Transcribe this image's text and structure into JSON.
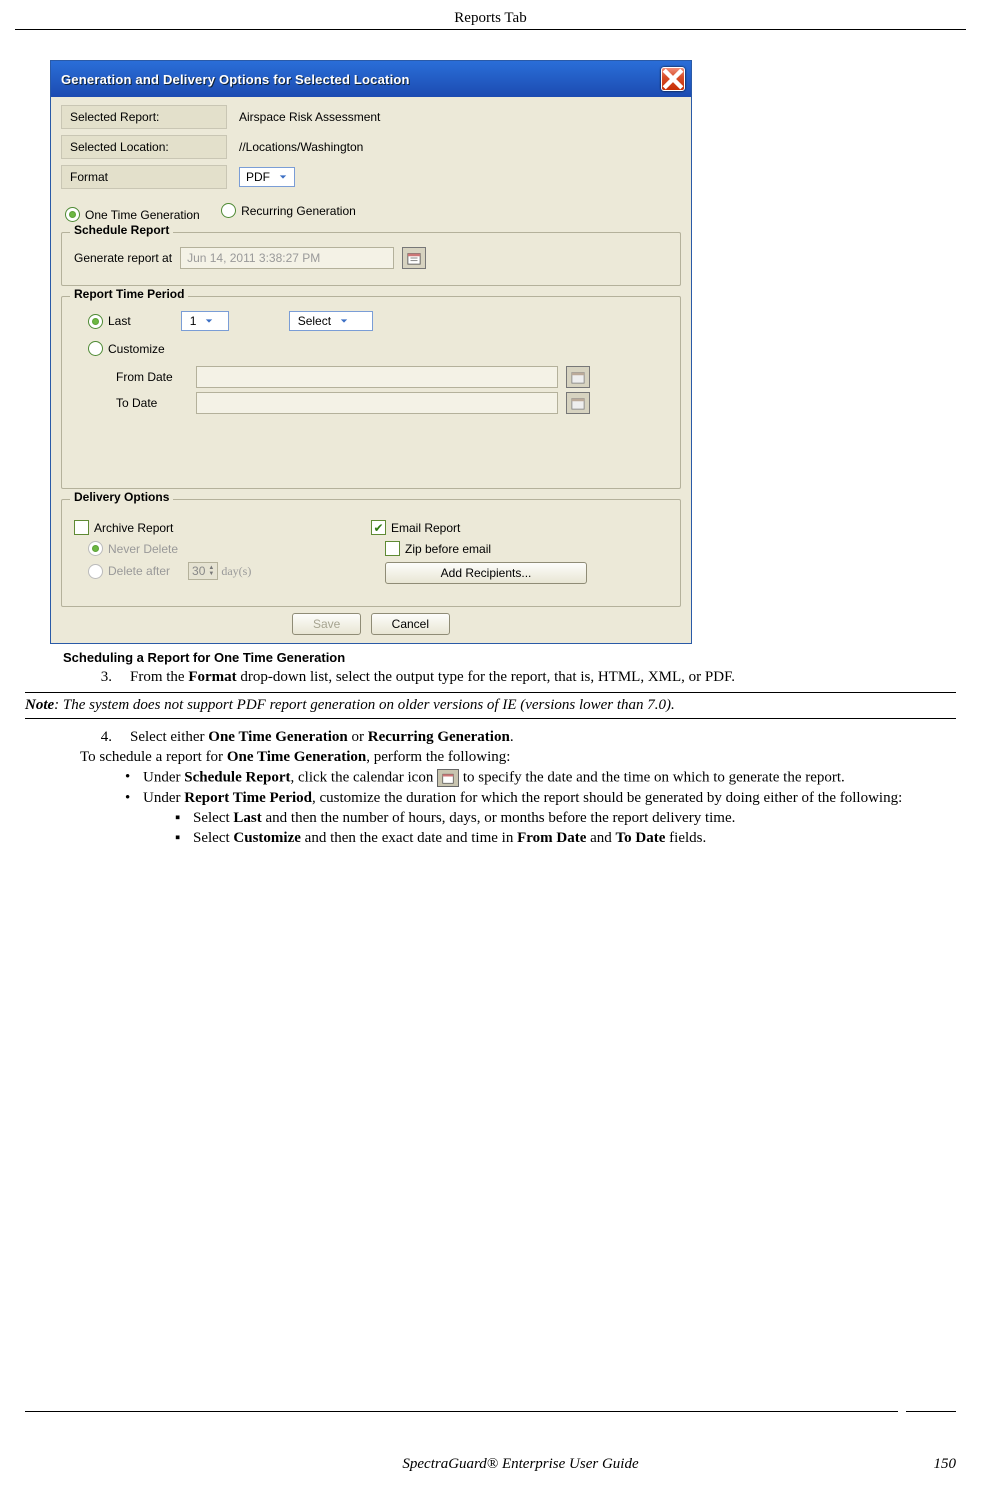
{
  "header": {
    "title": "Reports Tab"
  },
  "dialog": {
    "title": "Generation and Delivery Options for Selected Location",
    "rows": {
      "selectedReportLabel": "Selected Report:",
      "selectedReportValue": "Airspace Risk Assessment",
      "selectedLocationLabel": "Selected Location:",
      "selectedLocationValue": "//Locations/Washington",
      "formatLabel": "Format",
      "formatValue": "PDF"
    },
    "genOptions": {
      "oneTime": "One Time Generation",
      "recurring": "Recurring Generation"
    },
    "schedule": {
      "legend": "Schedule Report",
      "label": "Generate report at",
      "value": "Jun 14, 2011 3:38:27 PM"
    },
    "timePeriod": {
      "legend": "Report Time Period",
      "last": "Last",
      "lastNum": "1",
      "lastUnit": "Select",
      "customize": "Customize",
      "fromDate": "From Date",
      "toDate": "To Date"
    },
    "delivery": {
      "legend": "Delivery Options",
      "archive": "Archive Report",
      "neverDelete": "Never Delete",
      "deleteAfter": "Delete after",
      "deleteDays": "30",
      "deleteUnit": "day(s)",
      "emailReport": "Email Report",
      "zipBefore": "Zip before email",
      "addRecipients": "Add Recipients..."
    },
    "buttons": {
      "save": "Save",
      "cancel": "Cancel"
    }
  },
  "caption": "Scheduling a Report for One Time Generation",
  "step3": {
    "num": "3.",
    "t1": "From the ",
    "b1": "Format",
    "t2": " drop-down list, select the output type for the report, that is, HTML, XML, or PDF."
  },
  "note": {
    "label": "Note",
    "text": ": The system does not support PDF report generation on older versions of IE (versions lower than 7.0)."
  },
  "step4": {
    "num": "4.",
    "t1": "Select either ",
    "b1": "One Time Generation",
    "t2": " or ",
    "b2": "Recurring Generation",
    "t3": "."
  },
  "schedLine": {
    "t1": "To schedule a report for ",
    "b1": "One Time Generation",
    "t2": ", perform the following:"
  },
  "bullet1": {
    "t1": "Under ",
    "b1": "Schedule Report",
    "t2": ", click the calendar icon ",
    "t3": " to specify the date and the time on which to generate the report."
  },
  "bullet2": {
    "t1": "Under ",
    "b1": "Report Time Period",
    "t2": ", customize the duration for which the report should be generated by doing either of the following:"
  },
  "sub1": {
    "t1": "Select ",
    "b1": "Last",
    "t2": " and then the number of hours, days, or months before the report delivery time."
  },
  "sub2": {
    "t1": "Select ",
    "b1": "Customize",
    "t2": " and then the exact date and time in ",
    "b2": "From Date",
    "t3": " and ",
    "b3": "To Date",
    "t4": " fields."
  },
  "footer": {
    "title": "SpectraGuard®  Enterprise User Guide",
    "page": "150"
  }
}
